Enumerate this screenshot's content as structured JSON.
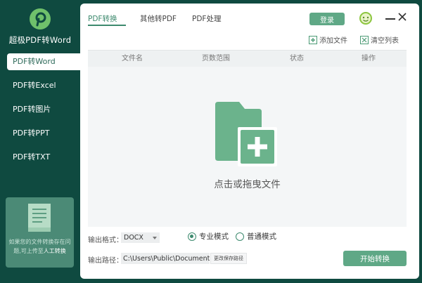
{
  "app": {
    "name": "超极PDF转Word"
  },
  "sidebar": {
    "items": [
      {
        "label": "PDF转Word"
      },
      {
        "label": "PDF转Excel"
      },
      {
        "label": "PDF转图片"
      },
      {
        "label": "PDF转PPT"
      },
      {
        "label": "PDF转TXT"
      }
    ],
    "active_index": 0,
    "help": {
      "text": "如果您的文件转换存在问题,可上传至",
      "link": "人工转换"
    }
  },
  "header": {
    "tabs": [
      {
        "label": "PDF转换"
      },
      {
        "label": "其他转PDF"
      },
      {
        "label": "PDF处理"
      }
    ],
    "active_tab": 0,
    "login_label": "登录"
  },
  "toolbar": {
    "add_file": "添加文件",
    "clear_list": "清空列表"
  },
  "table": {
    "columns": [
      "文件名",
      "页数范围",
      "状态",
      "操作"
    ]
  },
  "drop": {
    "text": "点击或拖曳文件"
  },
  "options": {
    "format_label": "输出格式：",
    "format_value": "DOCX",
    "modes": [
      {
        "label": "专业模式",
        "checked": true
      },
      {
        "label": "普通模式",
        "checked": false
      }
    ],
    "path_label": "输出路径：",
    "path_value": "C:\\Users\\Public\\Documents\\",
    "change_path": "更改保存路径",
    "start": "开始转换"
  },
  "colors": {
    "sidebar_bg": "#0f4a40",
    "accent": "#5fa886",
    "accent_dark": "#3d8a6e",
    "folder": "#6bb38c"
  }
}
